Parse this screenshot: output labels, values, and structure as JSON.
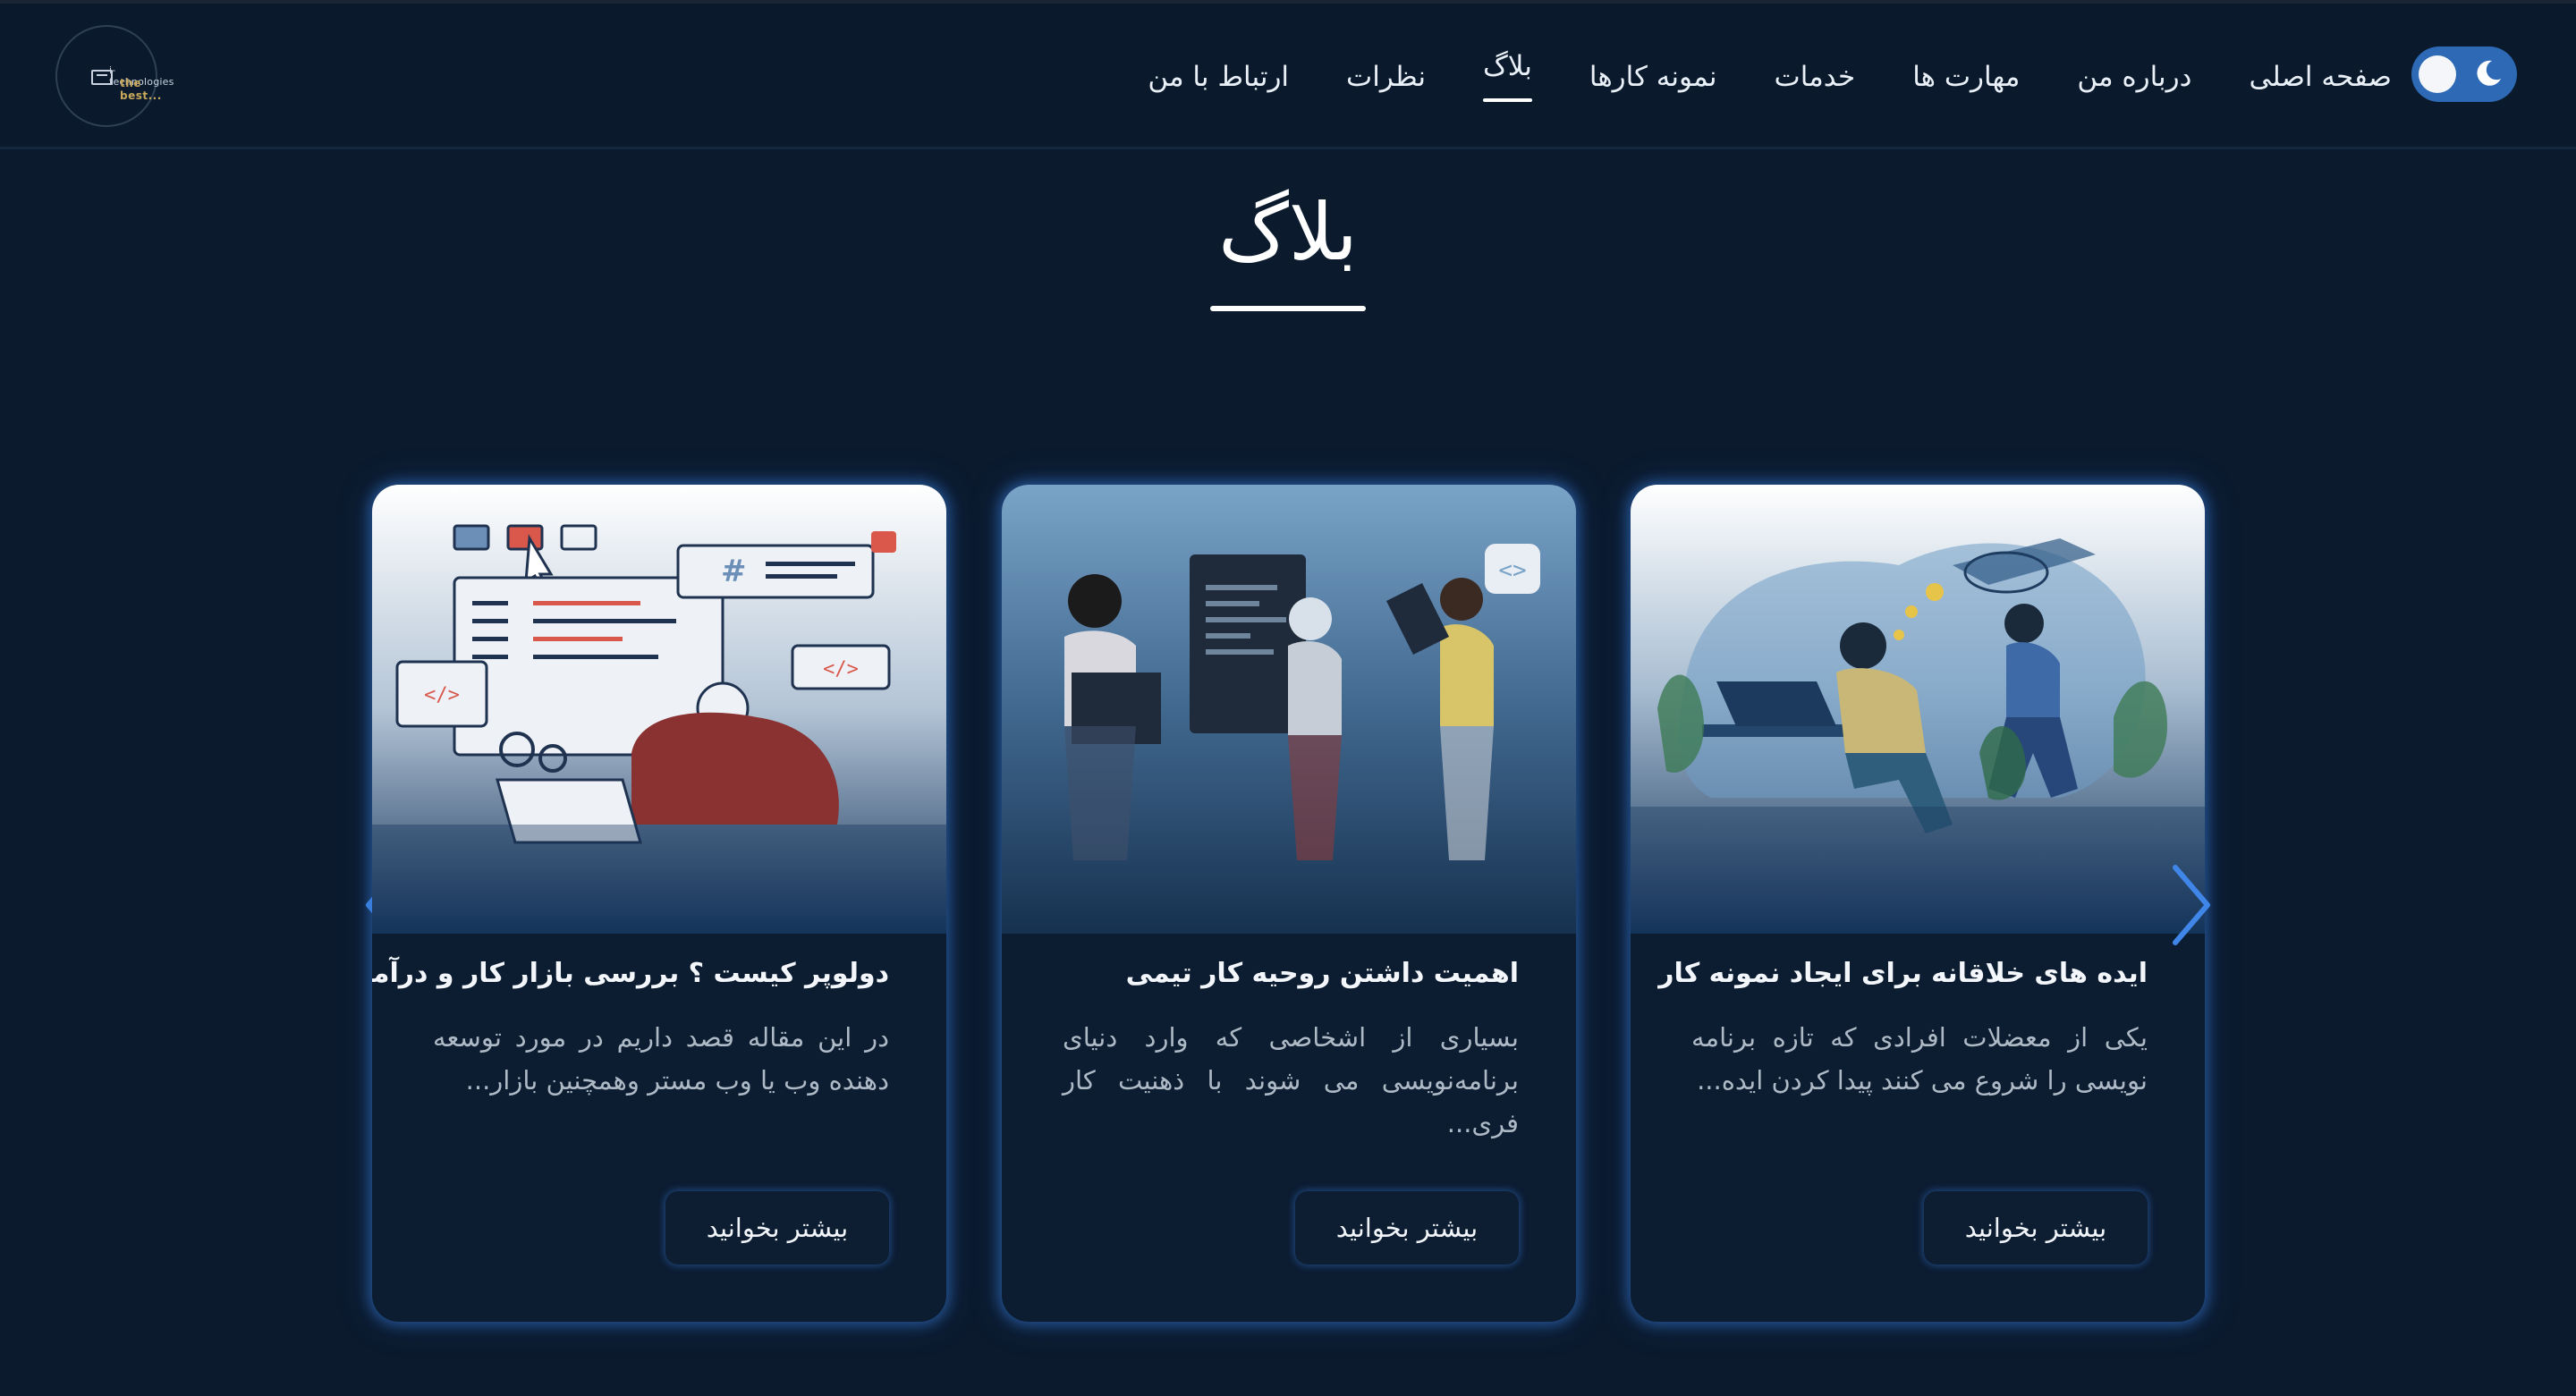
{
  "logo": {
    "line1": "i-technologies",
    "line2": "the best..."
  },
  "theme_toggle": {
    "state": "dark"
  },
  "nav": {
    "items": [
      {
        "label": "صفحه اصلی",
        "active": false
      },
      {
        "label": "درباره من",
        "active": false
      },
      {
        "label": "مهارت ها",
        "active": false
      },
      {
        "label": "خدمات",
        "active": false
      },
      {
        "label": "نمونه کارها",
        "active": false
      },
      {
        "label": "بلاگ",
        "active": true
      },
      {
        "label": "نظرات",
        "active": false
      },
      {
        "label": "ارتباط با من",
        "active": false
      }
    ]
  },
  "section": {
    "title": "بلاگ"
  },
  "cards": [
    {
      "title": "ایده های خلاقانه برای ایجاد نمونه کار",
      "excerpt": "یکی از معضلات افرادی که تازه برنامه نویسی را شروع می کنند پیدا کردن ایده...",
      "button": "بیشتر بخوانید"
    },
    {
      "title": "اهمیت داشتن روحیه کار تیمی",
      "excerpt": "بسیاری از اشخاصی که وارد دنیای برنامه‌نویسی می شوند با ذهنیت کار فری...",
      "button": "بیشتر بخوانید"
    },
    {
      "title": "دولوپر کیست ؟ بررسی بازار کار و درآمد",
      "excerpt": "در این مقاله قصد داریم در مورد توسعه دهنده وب یا وب مستر وهمچنین بازار...",
      "button": "بیشتر بخوانید"
    }
  ],
  "colors": {
    "background": "#0b1a2d",
    "accent": "#2e69b6",
    "arrow": "#3f86e8"
  }
}
